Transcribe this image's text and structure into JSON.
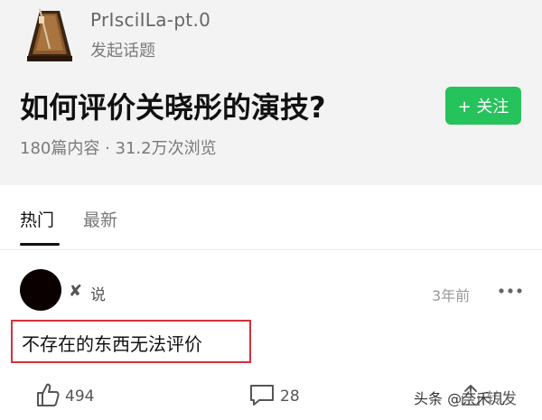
{
  "topic": {
    "author_name": "PrIsciILa-pt.0",
    "author_action": "发起话题",
    "title": "如何评价关晓彤的演技?",
    "follow_label": "+ 关注",
    "stats": "180篇内容 · 31.2万次浏览"
  },
  "tabs": [
    {
      "label": "热门",
      "active": true
    },
    {
      "label": "最新",
      "active": false
    }
  ],
  "post": {
    "author_glyph": "✘",
    "author_verb": "说",
    "time": "3年前",
    "text": "不存在的东西无法评价",
    "likes": "494",
    "comments": "28",
    "share_label": "转发"
  },
  "watermark": "头条 @奈禾几",
  "icons": {
    "avatar": "metronome-icon",
    "more": "more-dots-icon",
    "like": "thumbs-up-icon",
    "comment": "comment-bubble-icon",
    "share": "share-arrow-icon"
  },
  "colors": {
    "follow_button": "#26c25b",
    "highlight_border": "#d6303a",
    "header_bg": "#f3f3f3"
  }
}
